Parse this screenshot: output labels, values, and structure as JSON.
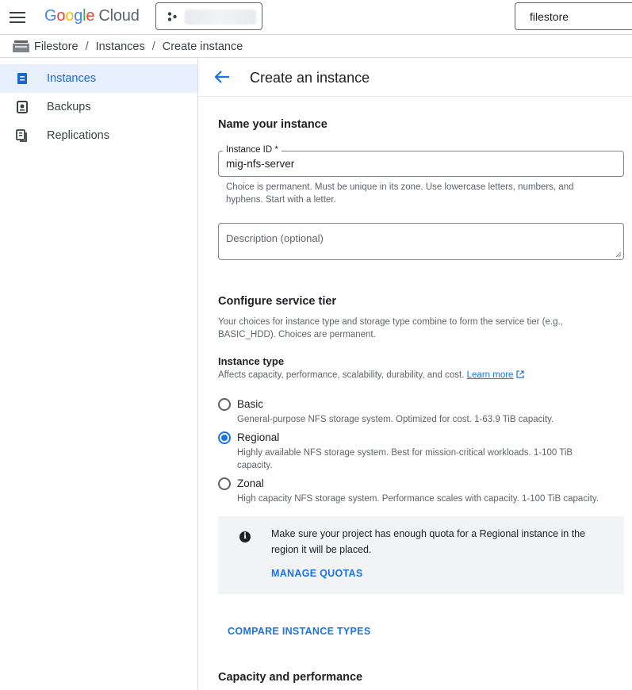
{
  "topbar": {
    "logo_letters": [
      "G",
      "o",
      "o",
      "g",
      "l",
      "e"
    ],
    "logo_product": "Cloud",
    "search_value": "filestore"
  },
  "breadcrumb": {
    "items": [
      "Filestore",
      "Instances",
      "Create instance"
    ],
    "separator": "/"
  },
  "sidebar": {
    "items": [
      {
        "label": "Instances",
        "icon": "instances-icon",
        "active": true
      },
      {
        "label": "Backups",
        "icon": "backups-icon",
        "active": false
      },
      {
        "label": "Replications",
        "icon": "replications-icon",
        "active": false
      }
    ]
  },
  "page": {
    "title": "Create an instance"
  },
  "name_section": {
    "title": "Name your instance",
    "instance_id_label": "Instance ID *",
    "instance_id_value": "mig-nfs-server",
    "instance_id_help_1": "Choice is permanent. Must be unique in its zone. Use lowercase letters, numbers, and",
    "instance_id_help_2": "hyphens. Start with a letter.",
    "description_placeholder": "Description (optional)"
  },
  "tier_section": {
    "title": "Configure service tier",
    "help_1": "Your choices for instance type and storage type combine to form the service tier (e.g.,",
    "help_2": "BASIC_HDD). Choices are permanent.",
    "instance_type_title": "Instance type",
    "instance_type_help": "Affects capacity, performance, scalability, durability, and cost.",
    "learn_more": "Learn more",
    "options": [
      {
        "label": "Basic",
        "desc": "General-purpose NFS storage system. Optimized for cost. 1-63.9 TiB capacity.",
        "checked": false
      },
      {
        "label": "Regional",
        "desc": "Highly available NFS storage system. Best for mission-critical workloads. 1-100 TiB capacity.",
        "checked": true
      },
      {
        "label": "Zonal",
        "desc": "High capacity NFS storage system. Performance scales with capacity. 1-100 TiB capacity.",
        "checked": false
      }
    ],
    "info_text": "Make sure your project has enough quota for a Regional instance in the region it will be placed.",
    "manage_quotas": "MANAGE QUOTAS",
    "compare_types": "COMPARE INSTANCE TYPES"
  },
  "capacity_section": {
    "title": "Capacity and performance"
  },
  "colors": {
    "accent": "#1a73e8",
    "active_bg": "#e8f0fe"
  }
}
